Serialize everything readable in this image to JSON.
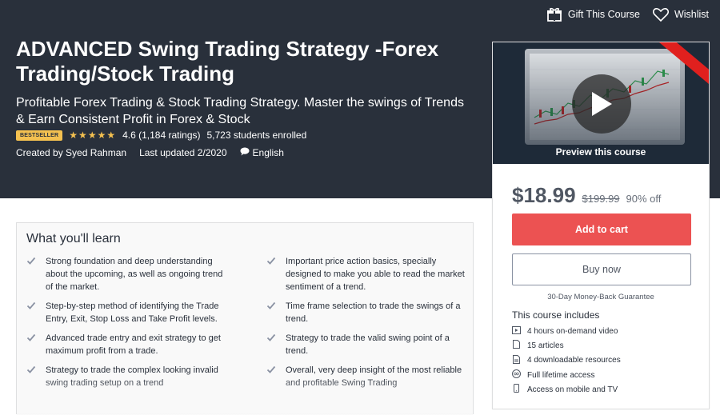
{
  "topbar": {
    "gift_label": "Gift This Course",
    "wishlist_label": "Wishlist"
  },
  "course": {
    "title": "ADVANCED Swing Trading Strategy -Forex Trading/Stock Trading",
    "subtitle": "Profitable Forex Trading & Stock Trading Strategy. Master the swings of Trends & Earn Consistent Profit in Forex & Stock",
    "badge": "BESTSELLER",
    "rating_text": "4.6 (1,184 ratings)",
    "rating_value": 4.6,
    "students": "5,723 students enrolled",
    "created_by": "Created by Syed Rahman",
    "last_updated": "Last updated 2/2020",
    "language": "English"
  },
  "sidebar": {
    "preview_label": "Preview this course",
    "price": "$18.99",
    "original_price": "$199.99",
    "discount": "90% off",
    "add_to_cart": "Add to cart",
    "buy_now": "Buy now",
    "guarantee": "30-Day Money-Back Guarantee",
    "includes_title": "This course includes",
    "includes": [
      {
        "icon": "video-icon",
        "label": "4 hours on-demand video"
      },
      {
        "icon": "article-icon",
        "label": "15 articles"
      },
      {
        "icon": "download-icon",
        "label": "4 downloadable resources"
      },
      {
        "icon": "infinity-icon",
        "label": "Full lifetime access"
      },
      {
        "icon": "mobile-icon",
        "label": "Access on mobile and TV"
      }
    ]
  },
  "learn": {
    "heading": "What you'll learn",
    "left": [
      "Strong foundation and deep understanding about the upcoming, as well as ongoing trend of the market.",
      "Step-by-step method of identifying the Trade Entry, Exit, Stop Loss and Take Profit levels.",
      "Advanced trade entry and exit strategy to get maximum profit from a trade.",
      "Strategy to trade the complex looking invalid swing trading setup on a trend"
    ],
    "right": [
      "Important price action basics, specially designed to make you able to read the market sentiment of a trend.",
      "Time frame selection to trade the swings of a trend.",
      "Strategy to trade the valid swing point of a trend.",
      "Overall, very deep insight of the most reliable and profitable Swing Trading"
    ]
  },
  "colors": {
    "hero_bg": "#29303b",
    "accent_red": "#ec5252",
    "star": "#f4c150"
  }
}
